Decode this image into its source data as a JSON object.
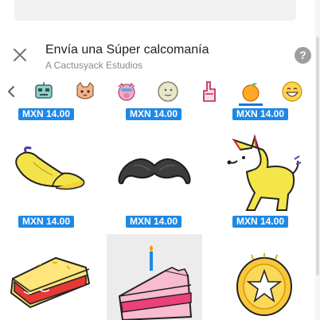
{
  "dialog": {
    "title": "Envía una Súper calcomanía",
    "subtitle": "A Cactusyack Estudios",
    "help_label": "?"
  },
  "tabs": [
    {
      "icon": "robot-sticker-icon"
    },
    {
      "icon": "cat-sticker-icon"
    },
    {
      "icon": "pig-sticker-icon"
    },
    {
      "icon": "moon-face-sticker-icon"
    },
    {
      "icon": "foam-finger-sticker-icon"
    },
    {
      "icon": "orange-sticker-icon",
      "selected": true
    },
    {
      "icon": "laughing-emoji-sticker-icon"
    }
  ],
  "stickers": [
    {
      "name": "sticker-partial-1",
      "price": "MXN 14.00"
    },
    {
      "name": "sticker-partial-2",
      "price": "MXN 14.00"
    },
    {
      "name": "sticker-partial-3",
      "price": "MXN 14.00"
    },
    {
      "name": "banana-peel-sticker",
      "price": "MXN 14.00"
    },
    {
      "name": "mustache-sticker",
      "price": "MXN 14.00"
    },
    {
      "name": "yellow-dog-sticker",
      "price": "MXN 14.00"
    },
    {
      "name": "cherry-pie-sticker"
    },
    {
      "name": "birthday-cake-sticker"
    },
    {
      "name": "gold-star-coin-sticker"
    }
  ],
  "colors": {
    "price_badge": "#1e88e5",
    "tab_indicator": "#1a73e8"
  }
}
